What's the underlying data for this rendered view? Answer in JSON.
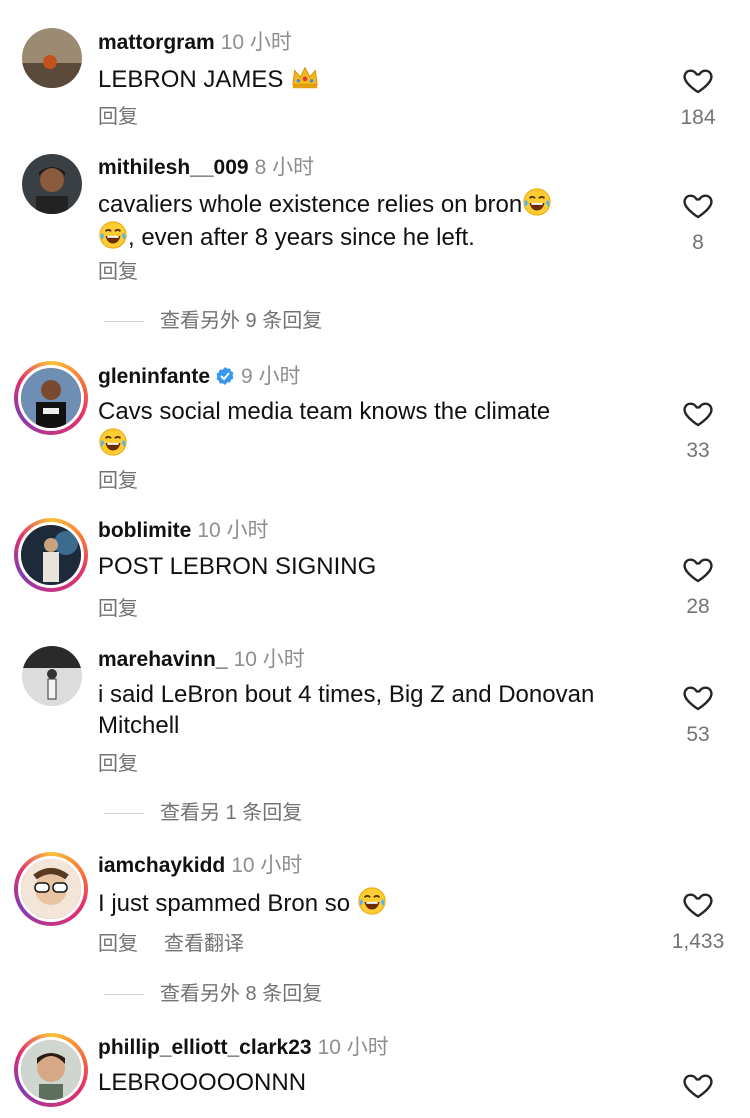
{
  "comments": [
    {
      "user": "mattorgram",
      "time": "10 小时",
      "text": "LEBRON JAMES ",
      "reply": "回复",
      "likes": "184"
    },
    {
      "user": "mithilesh__009",
      "time": "8 小时",
      "text1": "cavaliers whole existence relies on bron",
      "text2": ", even after 8 years since he left.",
      "reply": "回复",
      "likes": "8",
      "more": "查看另外 9 条回复"
    },
    {
      "user": "gleninfante",
      "time": "9 小时",
      "text": "Cavs social media team knows the climate",
      "reply": "回复",
      "likes": "33"
    },
    {
      "user": "boblimite",
      "time": "10 小时",
      "text": "POST LEBRON SIGNING",
      "reply": "回复",
      "likes": "28"
    },
    {
      "user": "marehavinn_",
      "time": "10 小时",
      "text": "i said LeBron bout 4 times, Big Z and Donovan Mitchell",
      "reply": "回复",
      "likes": "53",
      "more": "查看另 1 条回复"
    },
    {
      "user": "iamchaykidd",
      "time": "10 小时",
      "text": "I just spammed Bron so ",
      "reply": "回复",
      "translate": "查看翻译",
      "likes": "1,433",
      "more": "查看另外 8 条回复"
    },
    {
      "user": "phillip_elliott_clark23",
      "time": "10 小时",
      "text": "LEBROOOOONNN"
    }
  ],
  "icons": {
    "like": "heart-icon",
    "verified": "verified-badge-icon",
    "emoji_laugh": "laughing-emoji-icon",
    "emoji_crown": "crown-emoji-icon"
  },
  "colors": {
    "text": "#111111",
    "muted": "#737373",
    "verified": "#3797f0",
    "story_ring": "#e1306c"
  }
}
